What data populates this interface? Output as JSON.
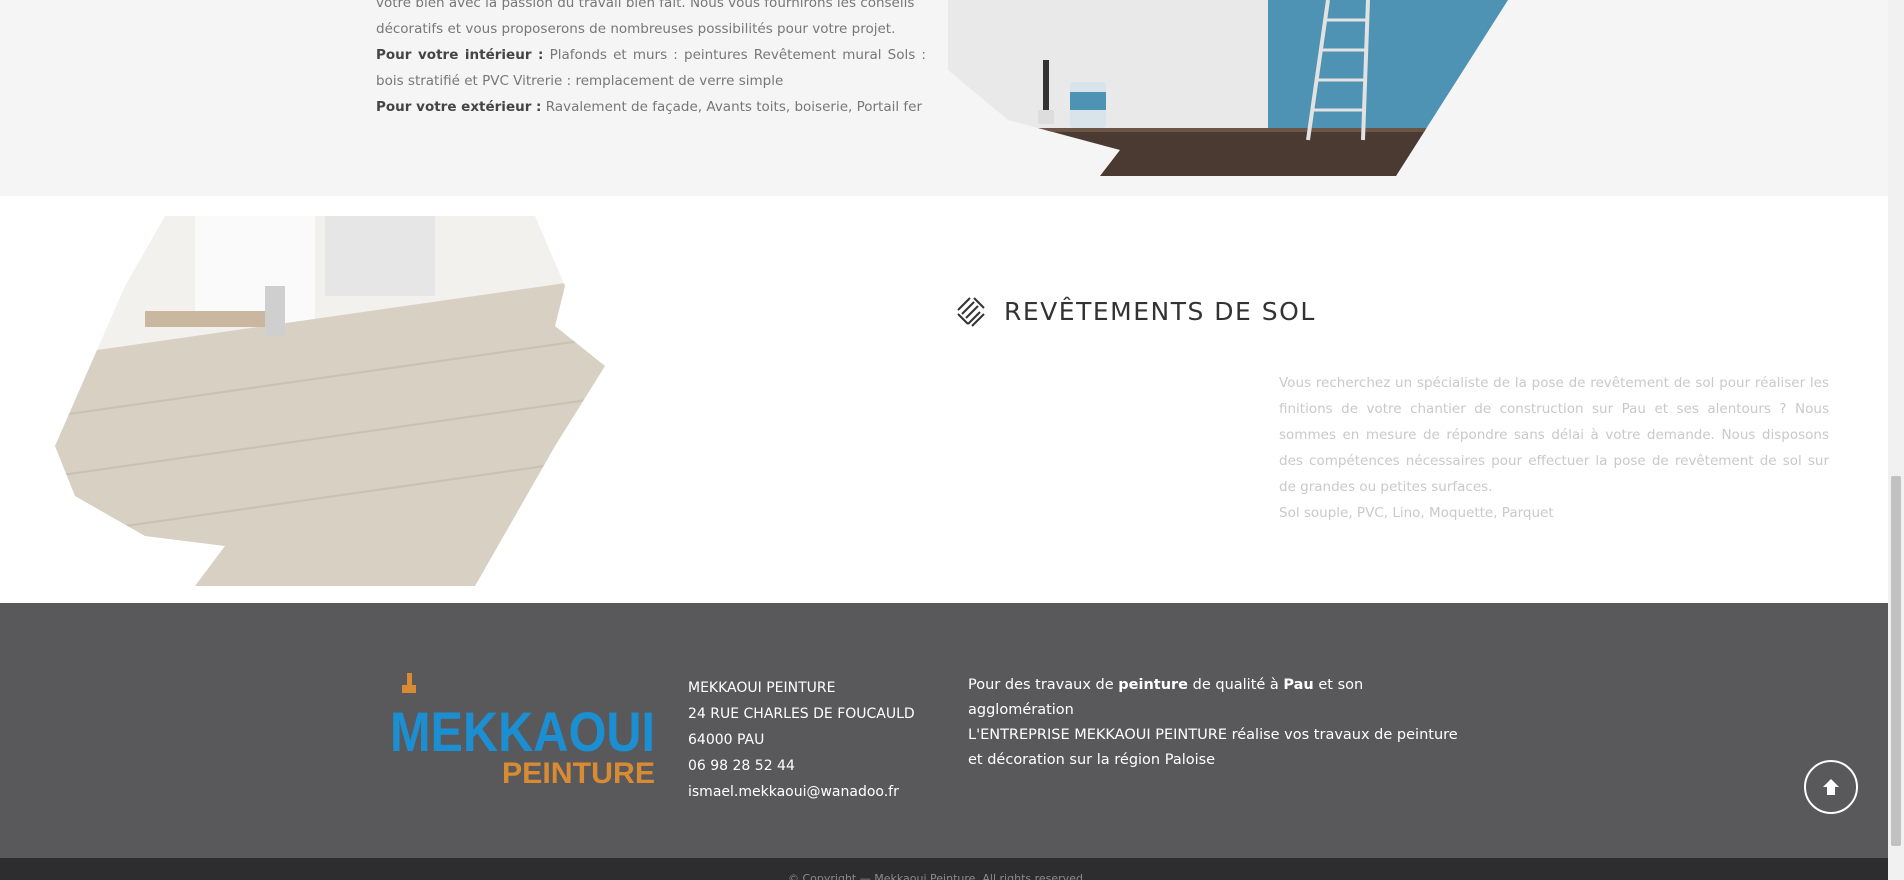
{
  "services": {
    "intro_lines": [
      "votre bien avec la passion du travail bien fait. Nous vous fournirons les conseils",
      "décoratifs et vous proposerons de nombreuses possibilités pour votre projet."
    ],
    "interior_label": "Pour votre intérieur :",
    "interior_text": " Plafonds et murs : peintures Revêtement mural Sols : bois stratifié et PVC Vitrerie : remplacement de verre simple",
    "exterior_label": "Pour votre extérieur :",
    "exterior_text": " Ravalement de façade, Avants toits, boiserie, Portail fer"
  },
  "floor": {
    "title": "REVÊTEMENTS DE SOL",
    "paragraph": "Vous recherchez un spécialiste de la pose de revêtement de sol pour réaliser les finitions de votre chantier de construction sur Pau et ses alentours ? Nous sommes en mesure de répondre sans délai à votre demande. Nous disposons des compétences nécessaires pour effectuer la pose de revêtement de sol sur de grandes ou petites surfaces.",
    "list": "Sol souple, PVC, Lino, Moquette, Parquet"
  },
  "footer": {
    "logo": {
      "line1": "MEKKAOUI",
      "line2": "PEINTURE"
    },
    "company": "MEKKAOUI PEINTURE",
    "street": "24 RUE CHARLES DE FOUCAULD",
    "city": "64000 PAU",
    "phone": "06 98 28 52 44",
    "email": "ismael.mekkaoui@wanadoo.fr",
    "slogan_1": "Pour des travaux de ",
    "slogan_b1": "peinture",
    "slogan_2": " de qualité à ",
    "slogan_b2": "Pau",
    "slogan_3": " et son agglomération",
    "slogan_line2": "L'ENTREPRISE MEKKAOUI PEINTURE réalise vos travaux de peinture et décoration sur la région Paloise",
    "copyright": "© Copyright — Mekkaoui Peinture. All rights reserved"
  },
  "colors": {
    "footer_bg": "#59595b",
    "logo_blue": "#1b8fd2",
    "logo_orange": "#d98b33"
  },
  "icons": {
    "section_icon": "parquet-pattern-icon",
    "scroll_top": "arrow-up-icon"
  }
}
